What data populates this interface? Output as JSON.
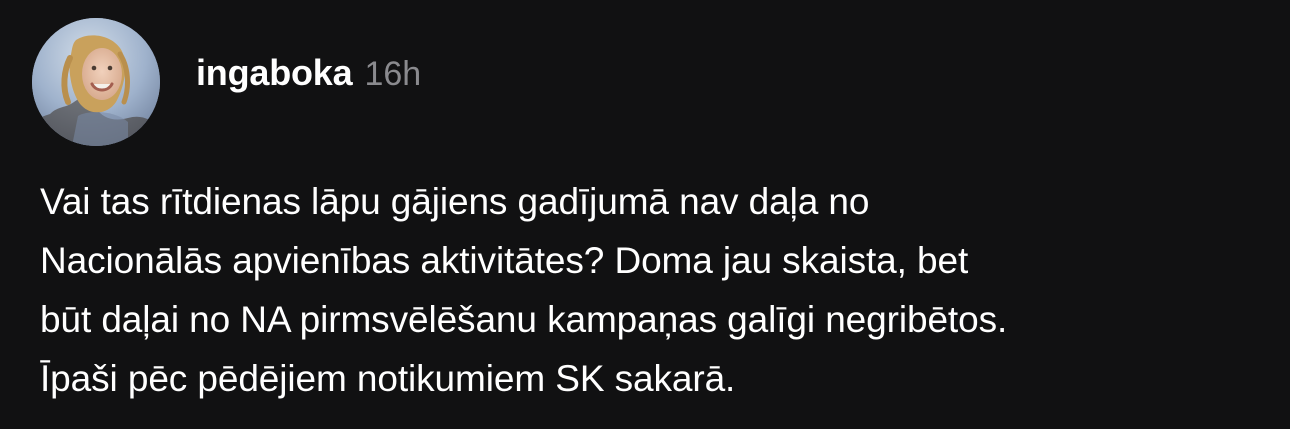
{
  "post": {
    "author": {
      "username": "ingaboka",
      "avatar_icon": "user-avatar-photo"
    },
    "timestamp": "16h",
    "text_lines": [
      "Vai tas rītdienas lāpu gājiens gadījumā nav daļa no",
      "Nacionālās apvienības aktivitātes? Doma jau skaista, bet",
      "būt daļai no NA pirmsvēlēšanu kampaņas galīgi negribētos.",
      "Īpaši pēc pēdējiem notikumiem SK sakarā."
    ]
  },
  "colors": {
    "background": "#111112",
    "text": "#ffffff",
    "muted": "#8a8a8e"
  }
}
